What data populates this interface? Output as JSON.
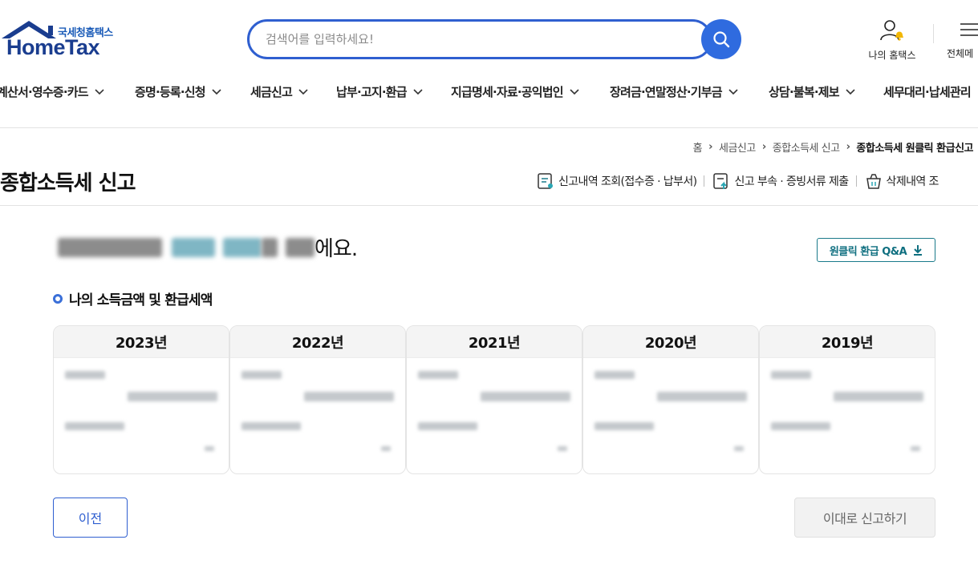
{
  "header": {
    "logo_sub": "국세청홈택스",
    "logo_main": "HomeTax",
    "search_placeholder": "검색어를 입력하세요!",
    "my_hometax": "나의 홈택스",
    "all_menu": "전체메"
  },
  "gnb": [
    {
      "label": "계산서·영수증·카드"
    },
    {
      "label": "증명·등록·신청"
    },
    {
      "label": "세금신고"
    },
    {
      "label": "납부·고지·환급"
    },
    {
      "label": "지급명세·자료·공익법인"
    },
    {
      "label": "장려금·연말정산·기부금"
    },
    {
      "label": "상담·불복·제보"
    },
    {
      "label": "세무대리·납세관리"
    }
  ],
  "breadcrumb": {
    "home": "홈",
    "level1": "세금신고",
    "level2": "종합소득세 신고",
    "current": "종합소득세 원클릭 환급신고"
  },
  "page": {
    "title": "종합소득세 신고",
    "util": [
      {
        "label": "신고내역 조회(접수증 · 납부서)"
      },
      {
        "label": "신고 부속 · 증빙서류 제출"
      },
      {
        "label": "삭제내역 조"
      }
    ]
  },
  "main": {
    "message_suffix": "에요.",
    "qa_button": "원클릭 환급 Q&A",
    "section_title": "나의 소득금액 및 환급세액",
    "years": [
      "2023년",
      "2022년",
      "2021년",
      "2020년",
      "2019년"
    ]
  },
  "footer": {
    "prev": "이전",
    "submit": "이대로 신고하기"
  },
  "colors": {
    "brand_blue": "#2f5fd0",
    "logo_blue": "#1a3d8f",
    "teal": "#0f6f80"
  }
}
